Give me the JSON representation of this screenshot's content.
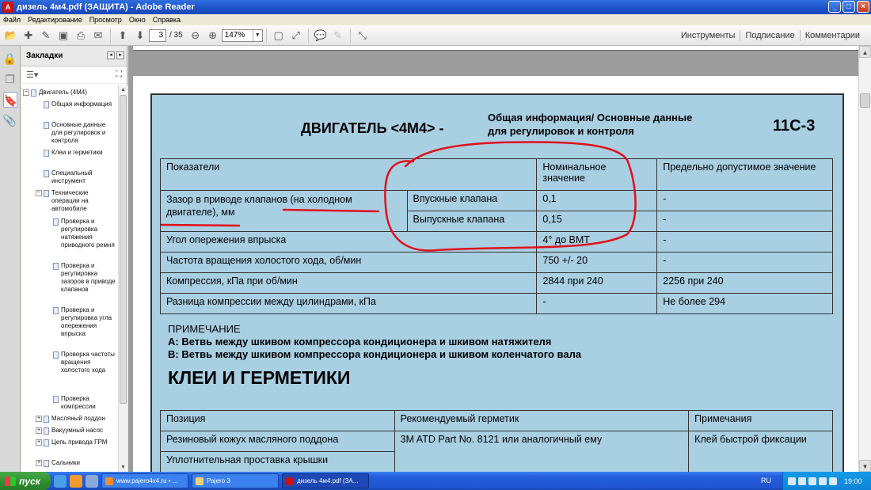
{
  "window": {
    "title": "дизель 4м4.pdf (ЗАЩИТА) - Adobe Reader"
  },
  "menu": [
    "Файл",
    "Редактирование",
    "Просмотр",
    "Окно",
    "Справка"
  ],
  "toolbar": {
    "page_current": "3",
    "page_total": "/ 35",
    "zoom": "147%",
    "links": [
      "Инструменты",
      "Подписание",
      "Комментарии"
    ]
  },
  "bookmarks": {
    "title": "Закладки",
    "items": [
      {
        "label": "Двигатель (4M4)",
        "level": 0,
        "toggle": "−"
      },
      {
        "label": "Общая информация",
        "level": 1
      },
      {
        "label": "Основные данные для регулировок и контроля",
        "level": 1
      },
      {
        "label": "Клеи и герметики",
        "level": 1
      },
      {
        "label": "Специальный инструмент",
        "level": 1
      },
      {
        "label": "Технические операции на автомобиле",
        "level": 1,
        "toggle": "−"
      },
      {
        "label": "Проверка и регулировка натяжения приводного ремня",
        "level": 2
      },
      {
        "label": "Проверка и регулировка зазоров в приводе клапанов",
        "level": 2
      },
      {
        "label": "Проверка и регулировка угла опережения впрыска",
        "level": 2
      },
      {
        "label": "Проверка частоты вращения холостого хода",
        "level": 2
      },
      {
        "label": "Проверка компрессии",
        "level": 2
      },
      {
        "label": "Масляный поддон",
        "level": 1,
        "toggle": "+"
      },
      {
        "label": "Вакуумный насос",
        "level": 1,
        "toggle": "+"
      },
      {
        "label": "Цепь привода ГРМ",
        "level": 1,
        "toggle": "+"
      },
      {
        "label": "Сальники",
        "level": 1,
        "toggle": "+"
      }
    ]
  },
  "document": {
    "chapter": "ДВИГАТЕЛЬ <4M4> -",
    "subtitle_line1": "Общая информация/ Основные данные",
    "subtitle_line2": "для регулировок и контроля",
    "page_code": "11C-3",
    "spec_table": {
      "headers": [
        "Показатели",
        "Номинальное значение",
        "Предельно допустимое значение"
      ],
      "valve_group": "Зазор в приводе клапанов (на холодном двигателе), мм",
      "valve_rows": [
        {
          "name": "Впускные клапана",
          "nominal": "0,1",
          "limit": "-"
        },
        {
          "name": "Выпускные клапана",
          "nominal": "0,15",
          "limit": "-"
        }
      ],
      "rows": [
        {
          "name": "Угол опережения впрыска",
          "nominal": "4° до ВМТ",
          "limit": "-"
        },
        {
          "name": "Частота вращения холостого хода, об/мин",
          "nominal": "750 +/- 20",
          "limit": "-"
        },
        {
          "name": "Компрессия, кПа при об/мин",
          "nominal": "2844 при 240",
          "limit": "2256 при 240"
        },
        {
          "name": "Разница компрессии между цилиндрами, кПа",
          "nominal": "-",
          "limit": "Не более 294"
        }
      ]
    },
    "note_title": "ПРИМЕЧАНИЕ",
    "note_a": "А: Ветвь между шкивом компрессора кондиционера и шкивом натяжителя",
    "note_b": "В: Ветвь между шкивом компрессора кондиционера и шкивом коленчатого вала",
    "section_heading": "КЛЕИ И ГЕРМЕТИКИ",
    "glue_table": {
      "headers": [
        "Позиция",
        "Рекомендуемый герметик",
        "Примечания"
      ],
      "rows": [
        {
          "pos": "Резиновый кожух масляного поддона",
          "sealant": "3M ATD Part No. 8121 или аналогичный ему",
          "note": "Клей быстрой фиксации"
        },
        {
          "pos": "Уплотнительная проставка крышки",
          "sealant": "",
          "note": ""
        }
      ]
    }
  },
  "taskbar": {
    "start": "пуск",
    "tasks": [
      "www.pajero4x4.ru • ...",
      "Pajero 3",
      "дизель 4м4.pdf (ЗА..."
    ],
    "lang": "RU",
    "clock": "19:00"
  },
  "colors": {
    "page_bg": "#a9cfe3",
    "annotation": "#e0101a",
    "titlebar": "#1c51c6"
  }
}
